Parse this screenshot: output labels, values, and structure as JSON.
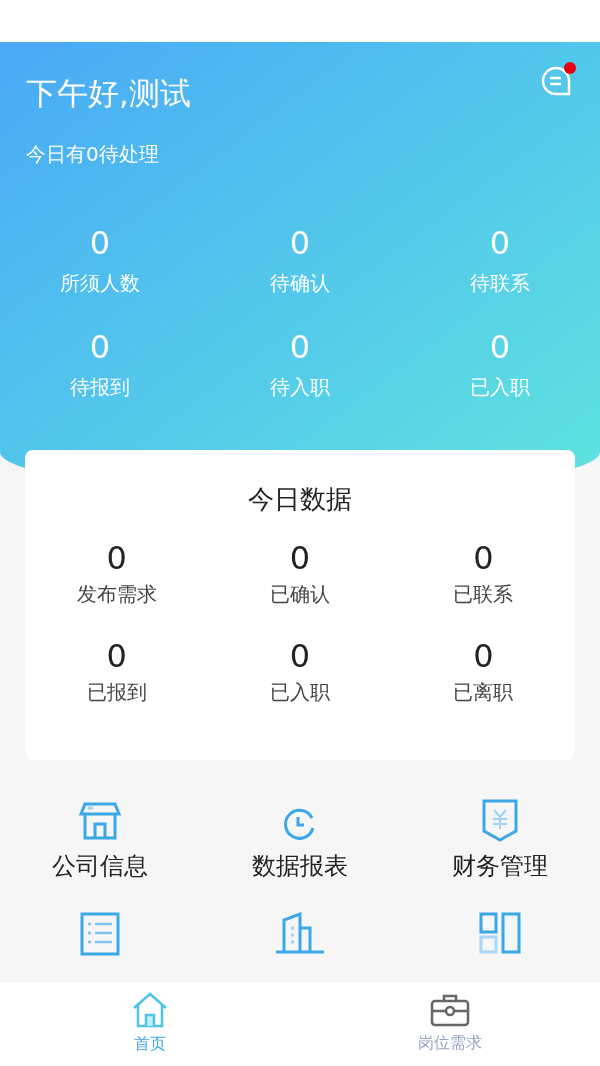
{
  "header": {
    "greeting": "下午好,测试",
    "subtitle": "今日有0待处理",
    "unread": true,
    "stats": [
      {
        "value": "0",
        "label": "所须人数"
      },
      {
        "value": "0",
        "label": "待确认"
      },
      {
        "value": "0",
        "label": "待联系"
      },
      {
        "value": "0",
        "label": "待报到"
      },
      {
        "value": "0",
        "label": "待入职"
      },
      {
        "value": "0",
        "label": "已入职"
      }
    ]
  },
  "today": {
    "title": "今日数据",
    "stats": [
      {
        "value": "0",
        "label": "发布需求"
      },
      {
        "value": "0",
        "label": "已确认"
      },
      {
        "value": "0",
        "label": "已联系"
      },
      {
        "value": "0",
        "label": "已报到"
      },
      {
        "value": "0",
        "label": "已入职"
      },
      {
        "value": "0",
        "label": "已离职"
      }
    ]
  },
  "menu": [
    {
      "label": "公司信息"
    },
    {
      "label": "数据报表"
    },
    {
      "label": "财务管理"
    }
  ],
  "tabs": [
    {
      "label": "首页",
      "selected": true
    },
    {
      "label": "岗位需求",
      "selected": false
    }
  ]
}
